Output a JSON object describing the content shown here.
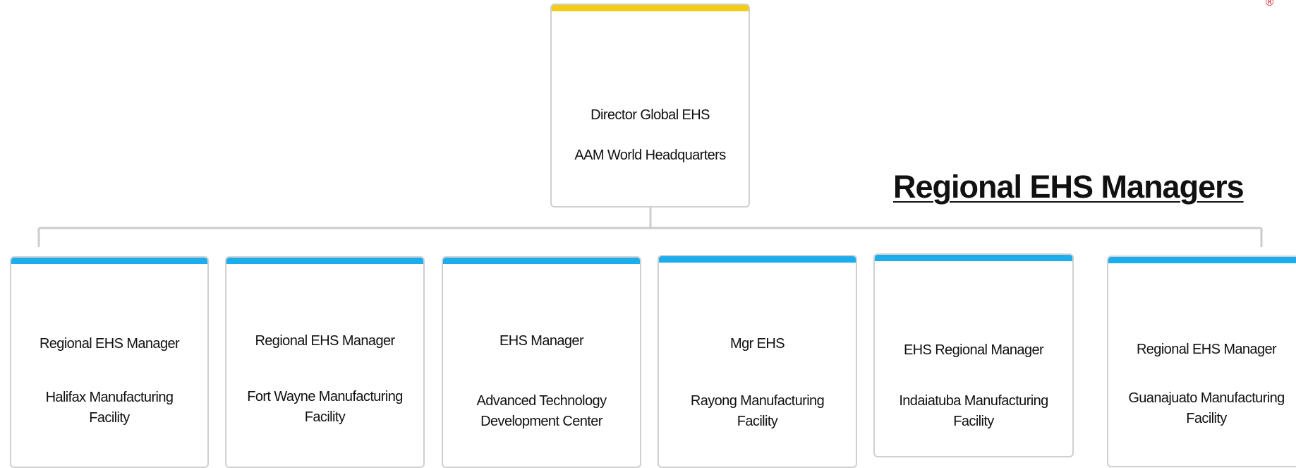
{
  "registered_mark": "®",
  "heading": "Regional EHS Managers",
  "colors": {
    "top_accent": "#f2cd14",
    "region_accent": "#1badec",
    "connector": "#cccccc",
    "box_border": "#d0d0d0"
  },
  "top": {
    "title": "Director Global EHS",
    "location": "AAM World Headquarters"
  },
  "regions": [
    {
      "title": "Regional EHS Manager",
      "location_line1": "Halifax Manufacturing",
      "location_line2": "Facility"
    },
    {
      "title": "Regional EHS Manager",
      "location_line1": "Fort Wayne Manufacturing",
      "location_line2": "Facility"
    },
    {
      "title": "EHS Manager",
      "location_line1": "Advanced Technology",
      "location_line2": "Development Center"
    },
    {
      "title": "Mgr EHS",
      "location_line1": "Rayong Manufacturing",
      "location_line2": "Facility"
    },
    {
      "title": "EHS Regional Manager",
      "location_line1": "Indaiatuba Manufacturing",
      "location_line2": "Facility"
    },
    {
      "title": "Regional EHS Manager",
      "location_line1": "Guanajuato Manufacturing",
      "location_line2": "Facility"
    }
  ]
}
